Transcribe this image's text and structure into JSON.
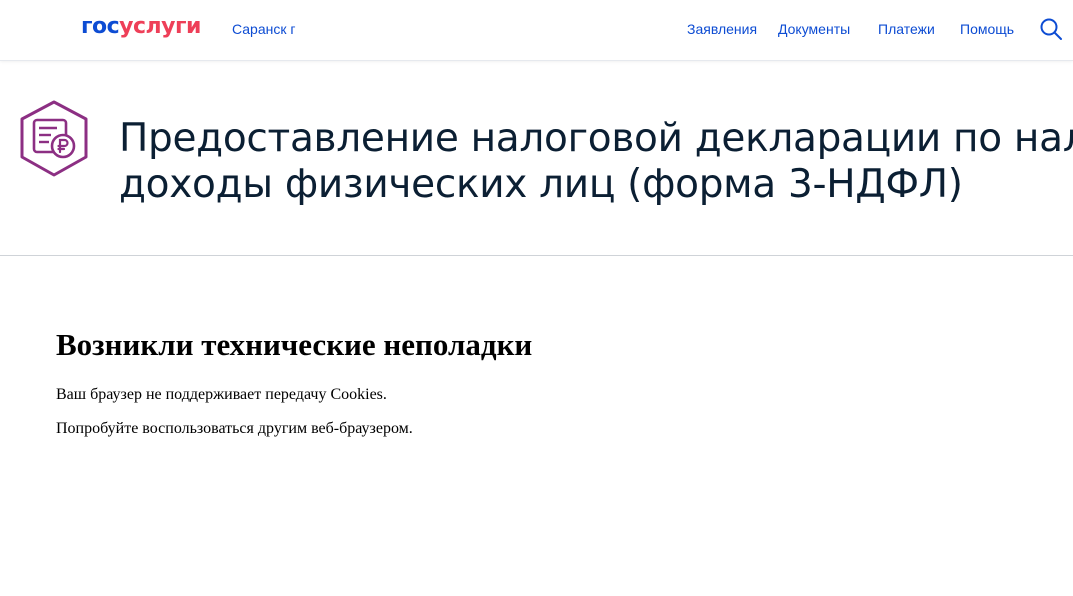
{
  "header": {
    "logo": {
      "part1": "гос",
      "part2": "услуги"
    },
    "city": "Саранск г",
    "nav": [
      {
        "label": "Заявления"
      },
      {
        "label": "Документы"
      },
      {
        "label": "Платежи"
      },
      {
        "label": "Помощь"
      }
    ],
    "search_icon": "search-icon"
  },
  "service": {
    "icon": "tax-document-ruble-icon",
    "title_line1": "Предоставление налоговой декларации по налогу на",
    "title_line2": "доходы физических лиц (форма 3-НДФЛ)"
  },
  "error": {
    "title": "Возникли технические неполадки",
    "message1": "Ваш браузер не поддерживает передачу Cookies.",
    "message2": "Попробуйте воспользоваться другим веб-браузером."
  },
  "colors": {
    "brand_blue": "#0d4cd3",
    "brand_red": "#ee3f58",
    "icon_purple": "#8c2f83",
    "title_text": "#0b1f33"
  }
}
